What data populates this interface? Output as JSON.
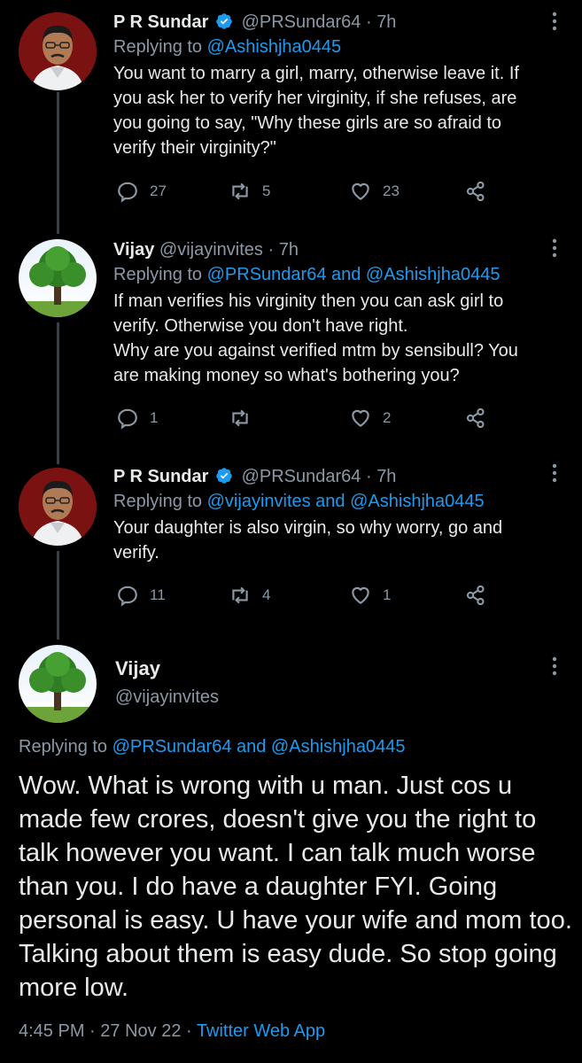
{
  "tweets": [
    {
      "name": "P R Sundar",
      "verified": true,
      "handle": "@PRSundar64",
      "dot": "·",
      "time": "7h",
      "reply_prefix": "Replying to",
      "reply_mentions": "@Ashishjha0445",
      "body_lines": [
        "You want to marry a girl, marry, otherwise leave it. If you ask her to verify her virginity, if she refuses, are you going to say, \"Why these girls are so afraid to verify their virginity?\""
      ],
      "replies": "27",
      "retweets": "5",
      "likes": "23"
    },
    {
      "name": "Vijay",
      "verified": false,
      "handle": "@vijayinvites",
      "dot": "·",
      "time": "7h",
      "reply_prefix": "Replying to",
      "reply_mentions": "@PRSundar64 and @Ashishjha0445",
      "body_lines": [
        "If man verifies his virginity then you can ask girl to verify. Otherwise you don't have right.",
        "Why are you against verified mtm by sensibull? You are making money so what's bothering you?"
      ],
      "replies": "1",
      "retweets": "",
      "likes": "2"
    },
    {
      "name": "P R Sundar",
      "verified": true,
      "handle": "@PRSundar64",
      "dot": "·",
      "time": "7h",
      "reply_prefix": "Replying to",
      "reply_mentions": "@vijayinvites and @Ashishjha0445",
      "body_lines": [
        "Your daughter is also virgin, so why worry, go and verify."
      ],
      "replies": "11",
      "retweets": "4",
      "likes": "1"
    }
  ],
  "main": {
    "name": "Vijay",
    "handle": "@vijayinvites",
    "reply_prefix": "Replying to",
    "reply_mentions": "@PRSundar64 and @Ashishjha0445",
    "body": "Wow. What is wrong with u man. Just cos u made few crores, doesn't give you the right to talk however you want. I can talk much worse than you. I do have a daughter FYI. Going personal is easy. U have your wife and mom too. Talking about them is easy dude. So stop going more low.",
    "time": "4:45 PM",
    "dot1": "·",
    "date": "27 Nov 22",
    "dot2": "·",
    "app": "Twitter Web App"
  },
  "colors": {
    "background": "#000000",
    "text": "#e7e9ea",
    "secondary": "#8b98a5",
    "link": "#1d9bf0",
    "verified_badge": "#1d9bf0"
  }
}
